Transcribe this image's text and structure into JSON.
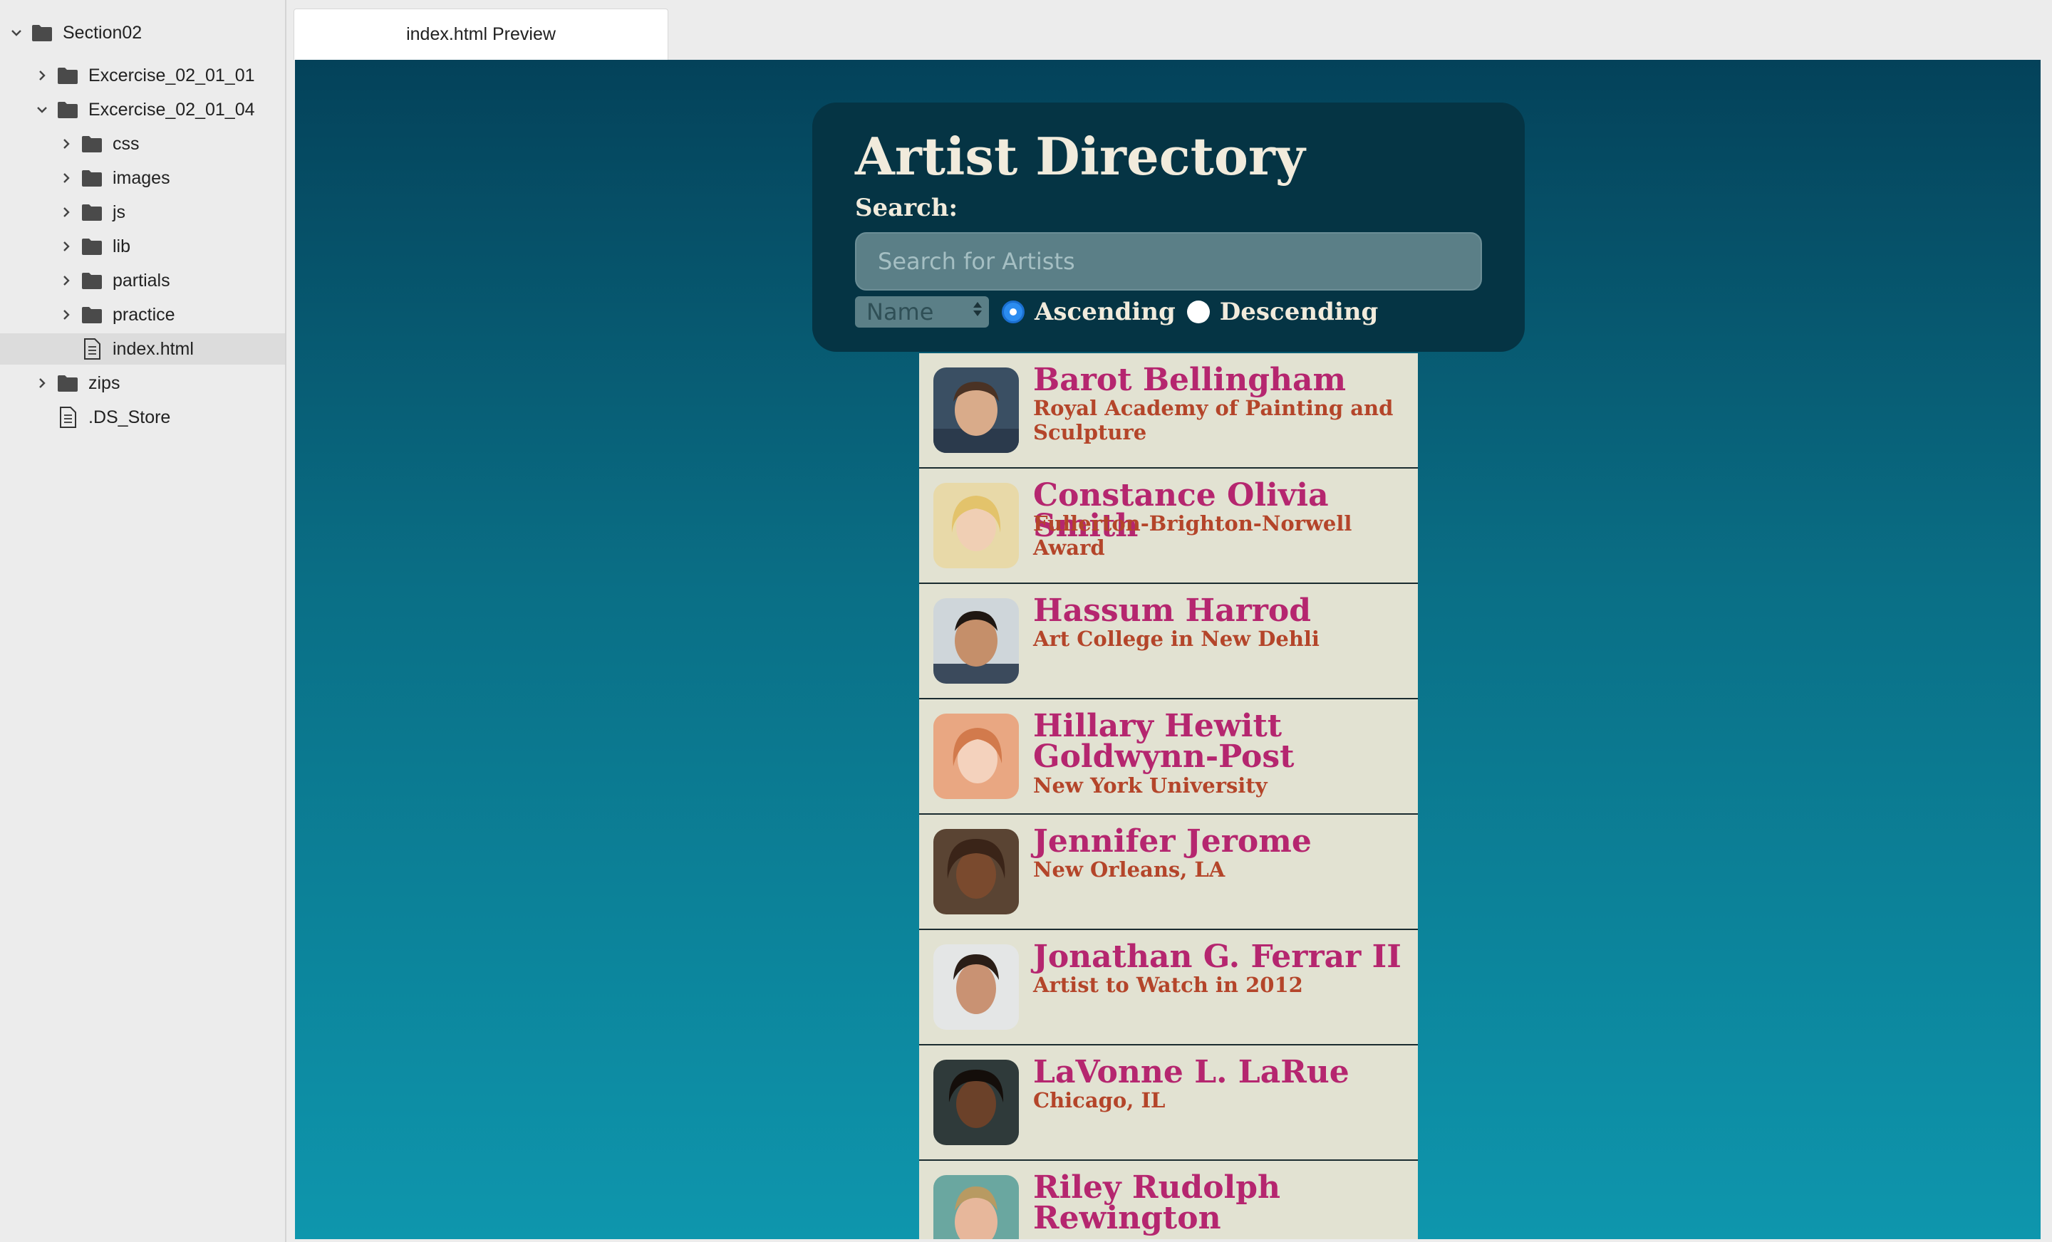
{
  "sidebar": {
    "items": [
      {
        "label": "Section02",
        "type": "folder",
        "expanded": true
      },
      {
        "label": "Excercise_02_01_01",
        "type": "folder",
        "expanded": false
      },
      {
        "label": "Excercise_02_01_04",
        "type": "folder",
        "expanded": true
      },
      {
        "label": "css",
        "type": "folder",
        "expanded": false
      },
      {
        "label": "images",
        "type": "folder",
        "expanded": false
      },
      {
        "label": "js",
        "type": "folder",
        "expanded": false
      },
      {
        "label": "lib",
        "type": "folder",
        "expanded": false
      },
      {
        "label": "partials",
        "type": "folder",
        "expanded": false
      },
      {
        "label": "practice",
        "type": "folder",
        "expanded": false
      },
      {
        "label": "index.html",
        "type": "file",
        "selected": true
      },
      {
        "label": "zips",
        "type": "folder",
        "expanded": false
      },
      {
        "label": ".DS_Store",
        "type": "file"
      }
    ]
  },
  "tab": {
    "label": "index.html Preview"
  },
  "app": {
    "title": "Artist Directory",
    "search_label": "Search:",
    "search_placeholder": "Search for Artists",
    "search_value": "",
    "sort_field": "Name",
    "order_ascending": "Ascending",
    "order_descending": "Descending",
    "order_selected": "Ascending"
  },
  "artists": [
    {
      "name": "Barot Bellingham",
      "reknown": "Royal Academy of Painting and Sculpture"
    },
    {
      "name": "Constance Olivia Smith",
      "reknown": "Fullerton-Brighton-Norwell Award"
    },
    {
      "name": "Hassum Harrod",
      "reknown": "Art College in New Dehli"
    },
    {
      "name": "Hillary Hewitt Goldwynn-Post",
      "reknown": "New York University"
    },
    {
      "name": "Jennifer Jerome",
      "reknown": "New Orleans, LA"
    },
    {
      "name": "Jonathan G. Ferrar II",
      "reknown": "Artist to Watch in 2012"
    },
    {
      "name": "LaVonne L. LaRue",
      "reknown": "Chicago, IL"
    },
    {
      "name": "Riley Rudolph Rewington",
      "reknown": ""
    }
  ],
  "colors": {
    "panel_bg": "#053444",
    "title_text": "#f1ebdc",
    "artist_name": "#b5266f",
    "artist_reknown": "#b4452a",
    "list_bg": "#e2e2d2",
    "preview_gradient_top": "#04425a",
    "preview_gradient_bottom": "#0e96ad"
  },
  "icons": {
    "folder": "folder-icon",
    "file": "file-icon",
    "expanded": "chevron-down-icon",
    "collapsed": "chevron-right-icon"
  }
}
